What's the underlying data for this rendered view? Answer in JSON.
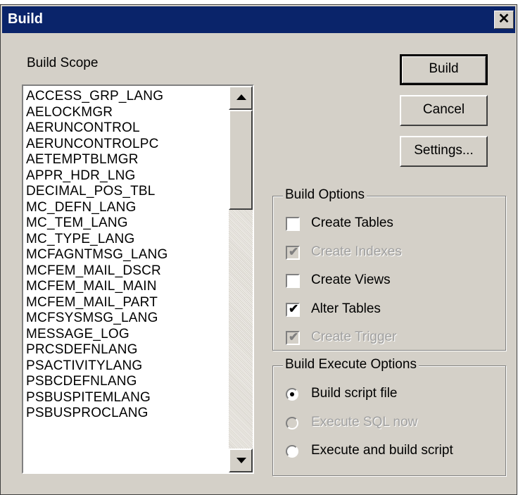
{
  "window": {
    "title": "Build",
    "close_glyph": "✕"
  },
  "build_scope": {
    "label": "Build Scope",
    "items": [
      "ACCESS_GRP_LANG",
      "AELOCKMGR",
      "AERUNCONTROL",
      "AERUNCONTROLPC",
      "AETEMPTBLMGR",
      "APPR_HDR_LNG",
      "DECIMAL_POS_TBL",
      "MC_DEFN_LANG",
      "MC_TEM_LANG",
      "MC_TYPE_LANG",
      "MCFAGNTMSG_LANG",
      "MCFEM_MAIL_DSCR",
      "MCFEM_MAIL_MAIN",
      "MCFEM_MAIL_PART",
      "MCFSYSMSG_LANG",
      "MESSAGE_LOG",
      "PRCSDEFNLANG",
      "PSACTIVITYLANG",
      "PSBCDEFNLANG",
      "PSBUSPITEMLANG",
      "PSBUSPROCLANG"
    ]
  },
  "buttons": {
    "build": "Build",
    "cancel": "Cancel",
    "settings": "Settings..."
  },
  "build_options": {
    "label": "Build Options",
    "create_tables": {
      "label": "Create Tables",
      "checked": false,
      "enabled": true
    },
    "create_indexes": {
      "label": "Create Indexes",
      "checked": true,
      "enabled": false
    },
    "create_views": {
      "label": "Create Views",
      "checked": false,
      "enabled": true
    },
    "alter_tables": {
      "label": "Alter Tables",
      "checked": true,
      "enabled": true
    },
    "create_trigger": {
      "label": "Create Trigger",
      "checked": true,
      "enabled": false
    }
  },
  "build_execute_options": {
    "label": "Build Execute Options",
    "build_script_file": {
      "label": "Build script file",
      "selected": true,
      "enabled": true
    },
    "execute_sql_now": {
      "label": "Execute SQL now",
      "selected": false,
      "enabled": false
    },
    "execute_and_build": {
      "label": "Execute and build script",
      "selected": false,
      "enabled": true
    }
  },
  "colors": {
    "titlebar": "#0a246a",
    "face": "#d4d0c8",
    "disabled_text": "#a0a0a0"
  }
}
